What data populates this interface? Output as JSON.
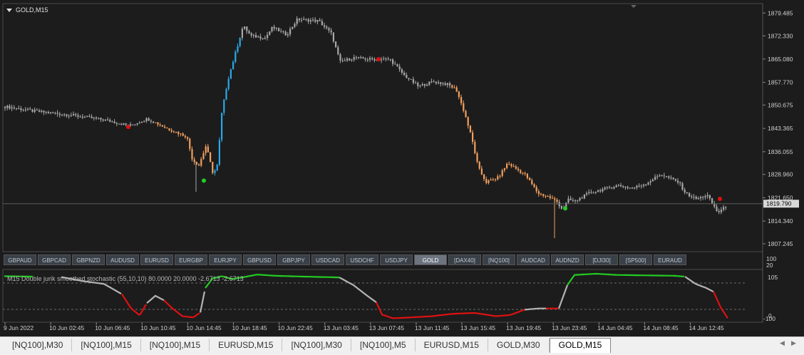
{
  "main": {
    "title": "GOLD,M15",
    "current_price": "1819.790",
    "price_ticks": [
      "1879.485",
      "1872.330",
      "1865.080",
      "1857.770",
      "1850.675",
      "1843.365",
      "1836.055",
      "1828.960",
      "1821.650",
      "1814.340",
      "1807.245"
    ],
    "price_range": [
      1805,
      1882
    ]
  },
  "symbols": [
    "GBPAUD",
    "GBPCAD",
    "GBPNZD",
    "AUDUSD",
    "EURUSD",
    "EURGBP",
    "EURJPY",
    "GBPUSD",
    "GBPJPY",
    "USDCAD",
    "USDCHF",
    "USDJPY",
    "GOLD",
    "[DAX40]",
    "[NQ100]",
    "AUDCAD",
    "AUDNZD",
    "[DJI30]",
    "[SP500]",
    "EURAUD"
  ],
  "active_symbol": "GOLD",
  "indicator": {
    "label": "M15 Double jurik smoothed stochastic (55,10,10) 80.0000 20.0000 -2.6713 -2.6713",
    "top_ticks": [
      "100",
      "20"
    ],
    "scale_ticks": [
      "105",
      "0",
      "-100"
    ]
  },
  "time_labels": [
    "9 Jun 2022",
    "10 Jun 02:45",
    "10 Jun 06:45",
    "10 Jun 10:45",
    "10 Jun 14:45",
    "10 Jun 18:45",
    "10 Jun 22:45",
    "13 Jun 03:45",
    "13 Jun 07:45",
    "13 Jun 11:45",
    "13 Jun 15:45",
    "13 Jun 19:45",
    "13 Jun 23:45",
    "14 Jun 04:45",
    "14 Jun 08:45",
    "14 Jun 12:45"
  ],
  "tabs": [
    "[NQ100],M30",
    "[NQ100],M15",
    "[NQ100],M15",
    "EURUSD,M15",
    "[NQ100],M30",
    "[NQ100],M5",
    "EURUSD,M15",
    "GOLD,M30",
    "GOLD,M15"
  ],
  "active_tab": "GOLD,M15",
  "colors": {
    "bg": "#1c1c1c",
    "bull": "#2aa8e8",
    "bear": "#f2a05f",
    "neutral": "#a8a8a8",
    "up": "#22cc22",
    "down": "#dd1111",
    "mid": "#b4b4b4"
  },
  "chart_data": {
    "type": "candlestick",
    "price_path": [
      [
        0,
        1850.2
      ],
      [
        40,
        1848.8
      ],
      [
        90,
        1847.6
      ],
      [
        140,
        1846.0
      ],
      [
        175,
        1844.2
      ],
      [
        200,
        1846.4
      ],
      [
        225,
        1843.6
      ],
      [
        255,
        1840.8
      ],
      [
        263,
        1833.5
      ],
      [
        272,
        1831.8
      ],
      [
        282,
        1838.0
      ],
      [
        292,
        1829.0
      ],
      [
        298,
        1832.0
      ],
      [
        304,
        1848.0
      ],
      [
        312,
        1858.0
      ],
      [
        322,
        1866.0
      ],
      [
        334,
        1875.5
      ],
      [
        345,
        1872.3
      ],
      [
        365,
        1871.7
      ],
      [
        375,
        1875.0
      ],
      [
        395,
        1872.7
      ],
      [
        410,
        1877.5
      ],
      [
        440,
        1877.0
      ],
      [
        458,
        1873.0
      ],
      [
        470,
        1864.2
      ],
      [
        490,
        1865.5
      ],
      [
        510,
        1865.0
      ],
      [
        540,
        1865.0
      ],
      [
        560,
        1860.0
      ],
      [
        580,
        1856.5
      ],
      [
        600,
        1858.0
      ],
      [
        620,
        1857.2
      ],
      [
        633,
        1855.6
      ],
      [
        645,
        1848.0
      ],
      [
        655,
        1840.0
      ],
      [
        664,
        1831.0
      ],
      [
        675,
        1826.5
      ],
      [
        692,
        1828.0
      ],
      [
        705,
        1832.5
      ],
      [
        730,
        1828.8
      ],
      [
        748,
        1823.0
      ],
      [
        762,
        1822.0
      ],
      [
        774,
        1820.5
      ],
      [
        782,
        1818.0
      ],
      [
        790,
        1821.0
      ],
      [
        800,
        1820.6
      ],
      [
        820,
        1823.2
      ],
      [
        860,
        1825.5
      ],
      [
        880,
        1824.6
      ],
      [
        900,
        1826.2
      ],
      [
        920,
        1829.0
      ],
      [
        945,
        1826.5
      ],
      [
        955,
        1823.0
      ],
      [
        970,
        1821.2
      ],
      [
        985,
        1822.5
      ],
      [
        1000,
        1817.0
      ],
      [
        1017,
        1819.8
      ]
    ],
    "markers": [
      {
        "x": 180,
        "y": 1843.8,
        "c": "down"
      },
      {
        "x": 286,
        "y": 1827.0,
        "c": "up"
      },
      {
        "x": 531,
        "y": 1865.0,
        "c": "down"
      },
      {
        "x": 793,
        "y": 1818.3,
        "c": "up"
      },
      {
        "x": 1010,
        "y": 1821.3,
        "c": "down"
      }
    ],
    "stochastic": {
      "y_range": [
        -100,
        110
      ],
      "levels": [
        80,
        20
      ],
      "points": [
        [
          0,
          104
        ],
        [
          40,
          103
        ],
        [
          80,
          102
        ],
        [
          110,
          92
        ],
        [
          140,
          85
        ],
        [
          165,
          60
        ],
        [
          178,
          25
        ],
        [
          190,
          8
        ],
        [
          200,
          38
        ],
        [
          212,
          56
        ],
        [
          224,
          45
        ],
        [
          236,
          25
        ],
        [
          250,
          6
        ],
        [
          265,
          3
        ],
        [
          275,
          15
        ],
        [
          282,
          75
        ],
        [
          292,
          98
        ],
        [
          305,
          104
        ],
        [
          320,
          97
        ],
        [
          340,
          103
        ],
        [
          355,
          108
        ],
        [
          380,
          105
        ],
        [
          420,
          103
        ],
        [
          470,
          101
        ],
        [
          490,
          82
        ],
        [
          510,
          55
        ],
        [
          522,
          40
        ],
        [
          530,
          10
        ],
        [
          545,
          1
        ],
        [
          560,
          2
        ],
        [
          580,
          4
        ],
        [
          600,
          6
        ],
        [
          630,
          12
        ],
        [
          660,
          14
        ],
        [
          690,
          6
        ],
        [
          710,
          9
        ],
        [
          730,
          22
        ],
        [
          750,
          25
        ],
        [
          778,
          25
        ],
        [
          790,
          82
        ],
        [
          800,
          107
        ],
        [
          830,
          110
        ],
        [
          860,
          107
        ],
        [
          900,
          106
        ],
        [
          940,
          105
        ],
        [
          955,
          103
        ],
        [
          970,
          85
        ],
        [
          985,
          75
        ],
        [
          995,
          66
        ],
        [
          1005,
          28
        ],
        [
          1015,
          1
        ]
      ],
      "segments": [
        {
          "from": 0,
          "to": 40,
          "c": "up"
        },
        {
          "from": 80,
          "to": 165,
          "c": "mid"
        },
        {
          "from": 165,
          "to": 200,
          "c": "down"
        },
        {
          "from": 200,
          "to": 224,
          "c": "mid"
        },
        {
          "from": 224,
          "to": 275,
          "c": "down"
        },
        {
          "from": 275,
          "to": 282,
          "c": "mid"
        },
        {
          "from": 282,
          "to": 470,
          "c": "up"
        },
        {
          "from": 470,
          "to": 522,
          "c": "mid"
        },
        {
          "from": 522,
          "to": 730,
          "c": "down"
        },
        {
          "from": 730,
          "to": 760,
          "c": "mid"
        },
        {
          "from": 760,
          "to": 778,
          "c": "down"
        },
        {
          "from": 778,
          "to": 790,
          "c": "mid"
        },
        {
          "from": 790,
          "to": 955,
          "c": "up"
        },
        {
          "from": 955,
          "to": 995,
          "c": "mid"
        },
        {
          "from": 995,
          "to": 1015,
          "c": "down"
        }
      ]
    }
  }
}
